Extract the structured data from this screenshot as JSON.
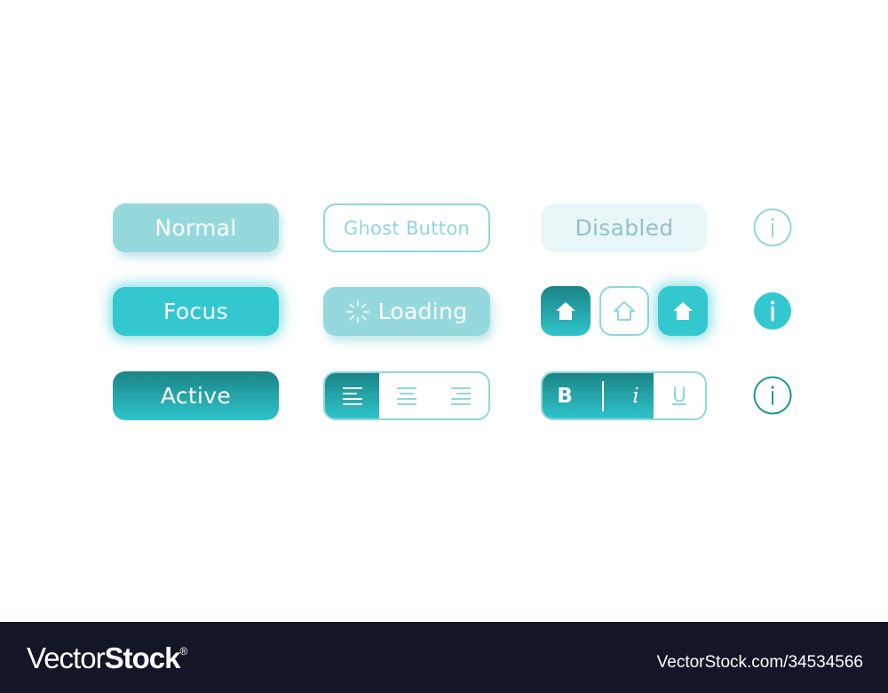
{
  "buttons": {
    "normal": "Normal",
    "ghost": "Ghost Button",
    "disabled": "Disabled",
    "focus": "Focus",
    "loading": "Loading",
    "active": "Active"
  },
  "align_group": {
    "options": [
      "align-left",
      "align-center",
      "align-right"
    ],
    "selected": "align-left"
  },
  "format_group": {
    "bold": "B",
    "italic": "i",
    "underline": "U",
    "selected": [
      "bold",
      "italic"
    ]
  },
  "home_buttons": [
    "home-dark",
    "home-outline",
    "home-bright"
  ],
  "colors": {
    "light_teal": "#95d9dc",
    "teal": "#33c8d0",
    "dark_teal": "#1b8486",
    "outline": "#8fd7db",
    "disabled_bg": "#e8f6f7",
    "footer_bg": "#131627"
  },
  "footer": {
    "logo_thin": "Vector",
    "logo_bold": "Stock",
    "logo_mark": "®",
    "image_id": "VectorStock.com/34534566"
  }
}
